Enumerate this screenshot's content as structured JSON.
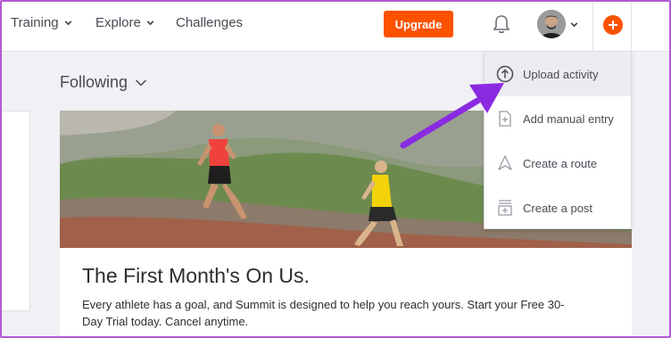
{
  "nav": {
    "items": [
      {
        "label": "Training",
        "has_menu": true
      },
      {
        "label": "Explore",
        "has_menu": true
      },
      {
        "label": "Challenges",
        "has_menu": false
      }
    ],
    "upgrade_label": "Upgrade",
    "notifications_icon": "bell-icon",
    "avatar_icon": "user-avatar",
    "add_icon": "plus-icon"
  },
  "feed": {
    "filter_label": "Following"
  },
  "promo": {
    "title": "The First Month's On Us.",
    "body": "Every athlete has a goal, and Summit is designed to help you reach yours. Start your Free 30-Day Trial today. Cancel anytime."
  },
  "dropdown": {
    "items": [
      {
        "label": "Upload activity",
        "icon": "upload-circle-icon",
        "highlighted": true
      },
      {
        "label": "Add manual entry",
        "icon": "document-plus-icon",
        "highlighted": false
      },
      {
        "label": "Create a route",
        "icon": "route-arrow-icon",
        "highlighted": false
      },
      {
        "label": "Create a post",
        "icon": "post-plus-icon",
        "highlighted": false
      }
    ]
  },
  "colors": {
    "brand": "#fc5200",
    "annotation_arrow": "#8a2be2"
  }
}
